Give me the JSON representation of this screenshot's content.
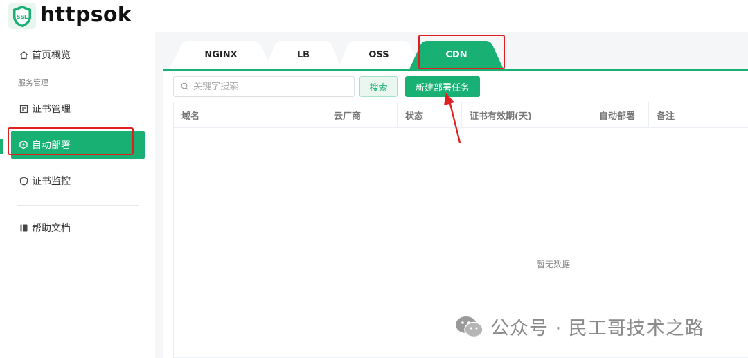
{
  "app": {
    "brand": "httpsok",
    "logo_text": "SSL"
  },
  "sidebar": {
    "items": [
      {
        "label": "首页概览",
        "icon": "home-icon"
      },
      {
        "label": "证书管理",
        "icon": "certificate-icon"
      },
      {
        "label": "自动部署",
        "icon": "deploy-icon"
      },
      {
        "label": "证书监控",
        "icon": "shield-icon"
      },
      {
        "label": "帮助文档",
        "icon": "book-icon"
      }
    ],
    "section_label": "服务管理",
    "active": "自动部署"
  },
  "tabs": [
    {
      "label": "NGINX"
    },
    {
      "label": "LB"
    },
    {
      "label": "OSS"
    },
    {
      "label": "CDN",
      "active": true
    }
  ],
  "toolbar": {
    "search_placeholder": "关键字搜索",
    "search_button": "搜索",
    "new_task_button": "新建部署任务"
  },
  "table": {
    "columns": [
      "域名",
      "云厂商",
      "状态",
      "证书有效期(天)",
      "自动部署",
      "备注"
    ],
    "rows": [],
    "empty_text": "暂无数据"
  },
  "watermark": {
    "text": "公众号 · 民工哥技术之路"
  },
  "colors": {
    "accent": "#19b074",
    "annotation": "#e02020"
  }
}
